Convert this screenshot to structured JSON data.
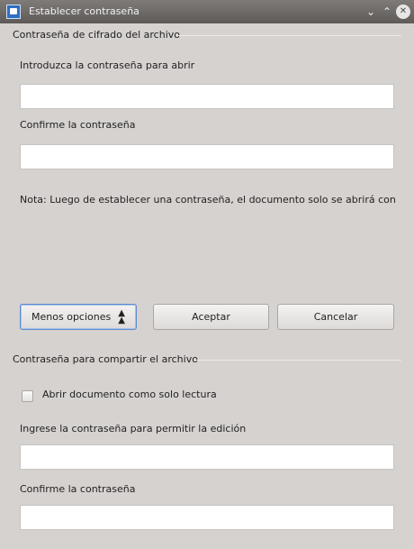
{
  "window": {
    "title": "Establecer contraseña",
    "min_glyph": "⌄",
    "max_glyph": "⌃",
    "close_glyph": "✕"
  },
  "encryption": {
    "section_title": "Contraseña de cifrado del archivo",
    "open_password_label": "Introduzca la contraseña para abrir",
    "open_password_value": "",
    "confirm_label": "Confirme la contraseña",
    "confirm_value": "",
    "note": "Nota: Luego de establecer una contraseña, el documento solo se abrirá con"
  },
  "buttons": {
    "less_options": "Menos opciones",
    "less_options_icon": "double-chevron-up-icon",
    "accept": "Aceptar",
    "cancel": "Cancelar"
  },
  "sharing": {
    "section_title": "Contraseña para compartir el archivo",
    "readonly_label": "Abrir documento como solo lectura",
    "readonly_checked": false,
    "edit_password_label": "Ingrese la contraseña para permitir la edición",
    "edit_password_value": "",
    "confirm_label": "Confirme la contraseña",
    "confirm_value": ""
  }
}
